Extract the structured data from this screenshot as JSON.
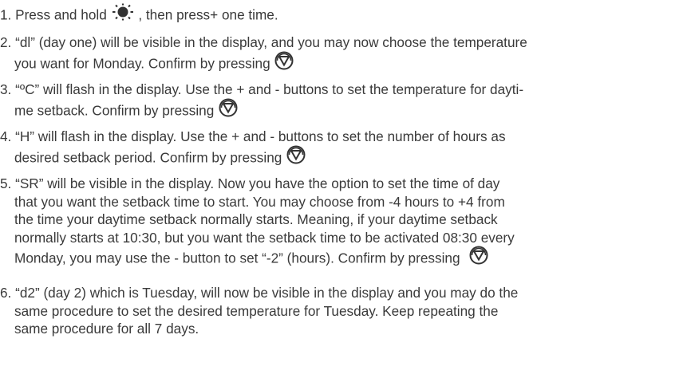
{
  "steps": [
    {
      "lines": [
        "1. Press and hold",
        ", then press+ one time."
      ]
    },
    {
      "lines": [
        "2. “dl” (day one) will be visible in the display, and you may now choose the temperature",
        "you want for Monday. Confirm by pressing"
      ]
    },
    {
      "lines": [
        "3. “ºC” will flash in the display. Use the + and - buttons to set the temperature for dayti-",
        "me setback. Confirm by pressing"
      ]
    },
    {
      "lines": [
        "4. “H” will flash in the display. Use the + and - buttons to set the number of hours as",
        "desired setback period. Confirm by pressing"
      ]
    },
    {
      "lines": [
        "5. “SR” will be visible in the display. Now you have the option to set the time of day",
        "that you want the setback time to start. You may choose from -4 hours to +4 from",
        "the time your daytime setback normally starts. Meaning, if your daytime setback",
        "normally starts at 10:30, but you want the setback time to be activated 08:30 every",
        "Monday, you may use the - button to set “-2” (hours). Confirm by pressing"
      ]
    },
    {
      "lines": [
        "6. “d2” (day 2) which is Tuesday, will now be visible in the display and you may do the",
        "same procedure to set the desired temperature for Tuesday. Keep repeating the",
        "same procedure for all 7 days."
      ]
    }
  ],
  "icons": {
    "sun": "sun-icon",
    "gear": "gear-icon"
  },
  "colors": {
    "text": "#3a3a3a",
    "icon": "#333333"
  }
}
